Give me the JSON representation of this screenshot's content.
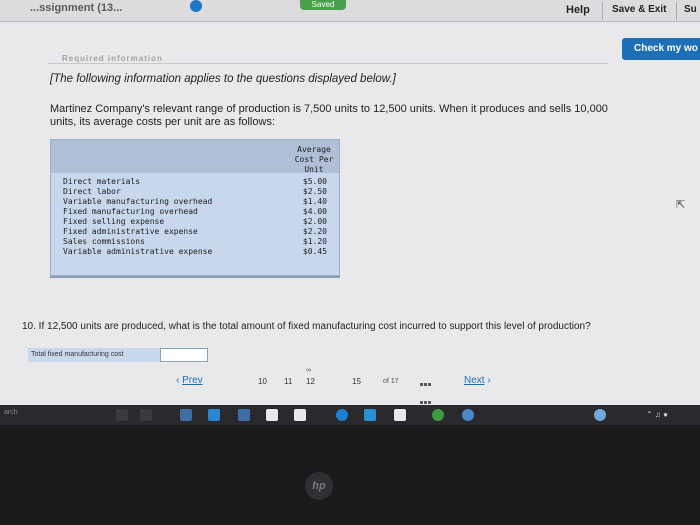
{
  "header": {
    "assignment_title": "...ssignment (13...",
    "saved_label": "Saved",
    "help_label": "Help",
    "save_exit_label": "Save & Exit",
    "submit_label": "Su"
  },
  "check_work_label": "Check my wo",
  "section_heading": "Required information",
  "intro_note": "[The following information applies to the questions displayed below.]",
  "problem_text": "Martinez Company's relevant range of production is 7,500 units to 12,500 units. When it produces and sells 10,000 units, its average costs per unit are as follows:",
  "cost_table": {
    "column_header": [
      "Average",
      "Cost Per",
      "Unit"
    ],
    "rows": [
      {
        "label": "Direct materials",
        "value": "$5.00"
      },
      {
        "label": "Direct labor",
        "value": "$2.50"
      },
      {
        "label": "Variable manufacturing overhead",
        "value": "$1.40"
      },
      {
        "label": "Fixed manufacturing overhead",
        "value": "$4.00"
      },
      {
        "label": "Fixed selling expense",
        "value": "$2.00"
      },
      {
        "label": "Fixed administrative expense",
        "value": "$2.20"
      },
      {
        "label": "Sales commissions",
        "value": "$1.20"
      },
      {
        "label": "Variable administrative expense",
        "value": "$0.45"
      }
    ]
  },
  "question": "10. If 12,500 units are produced, what is the total amount of fixed manufacturing cost incurred to support this level of production?",
  "answer": {
    "label": "Total fixed manufacturing cost",
    "value": ""
  },
  "pagination": {
    "prev_label": "Prev",
    "pages": [
      "10",
      "11",
      "12",
      "15"
    ],
    "current": "12",
    "of_label": "of 17",
    "next_label": "Next"
  },
  "taskbar": {
    "search_label": "arch"
  },
  "brand": "hp",
  "colors": {
    "accent": "#1d6fb8",
    "saved": "#4aa04a",
    "table_bg": "#c7d7ec"
  }
}
